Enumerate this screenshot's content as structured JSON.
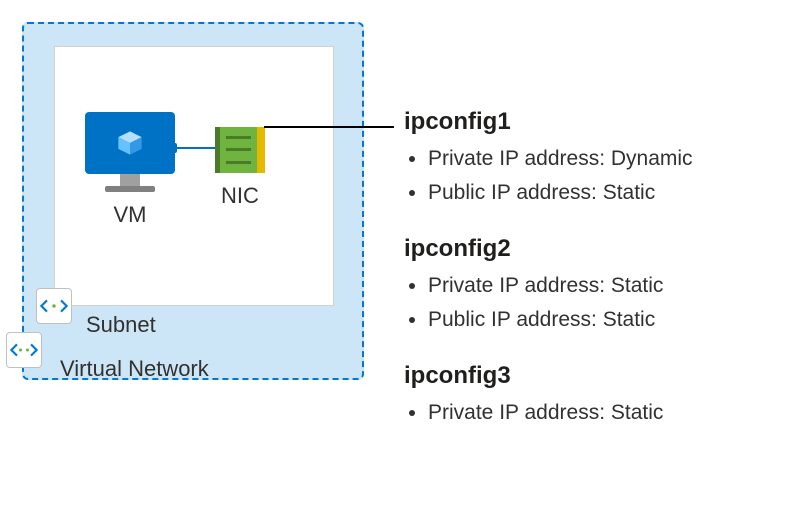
{
  "diagram": {
    "vnet_label": "Virtual Network",
    "subnet_label": "Subnet",
    "vm_label": "VM",
    "nic_label": "NIC"
  },
  "configs": [
    {
      "name": "ipconfig1",
      "items": [
        "Private IP address: Dynamic",
        "Public IP address: Static"
      ]
    },
    {
      "name": "ipconfig2",
      "items": [
        "Private IP address: Static",
        "Public IP address: Static"
      ]
    },
    {
      "name": "ipconfig3",
      "items": [
        "Private IP address: Static"
      ]
    }
  ]
}
